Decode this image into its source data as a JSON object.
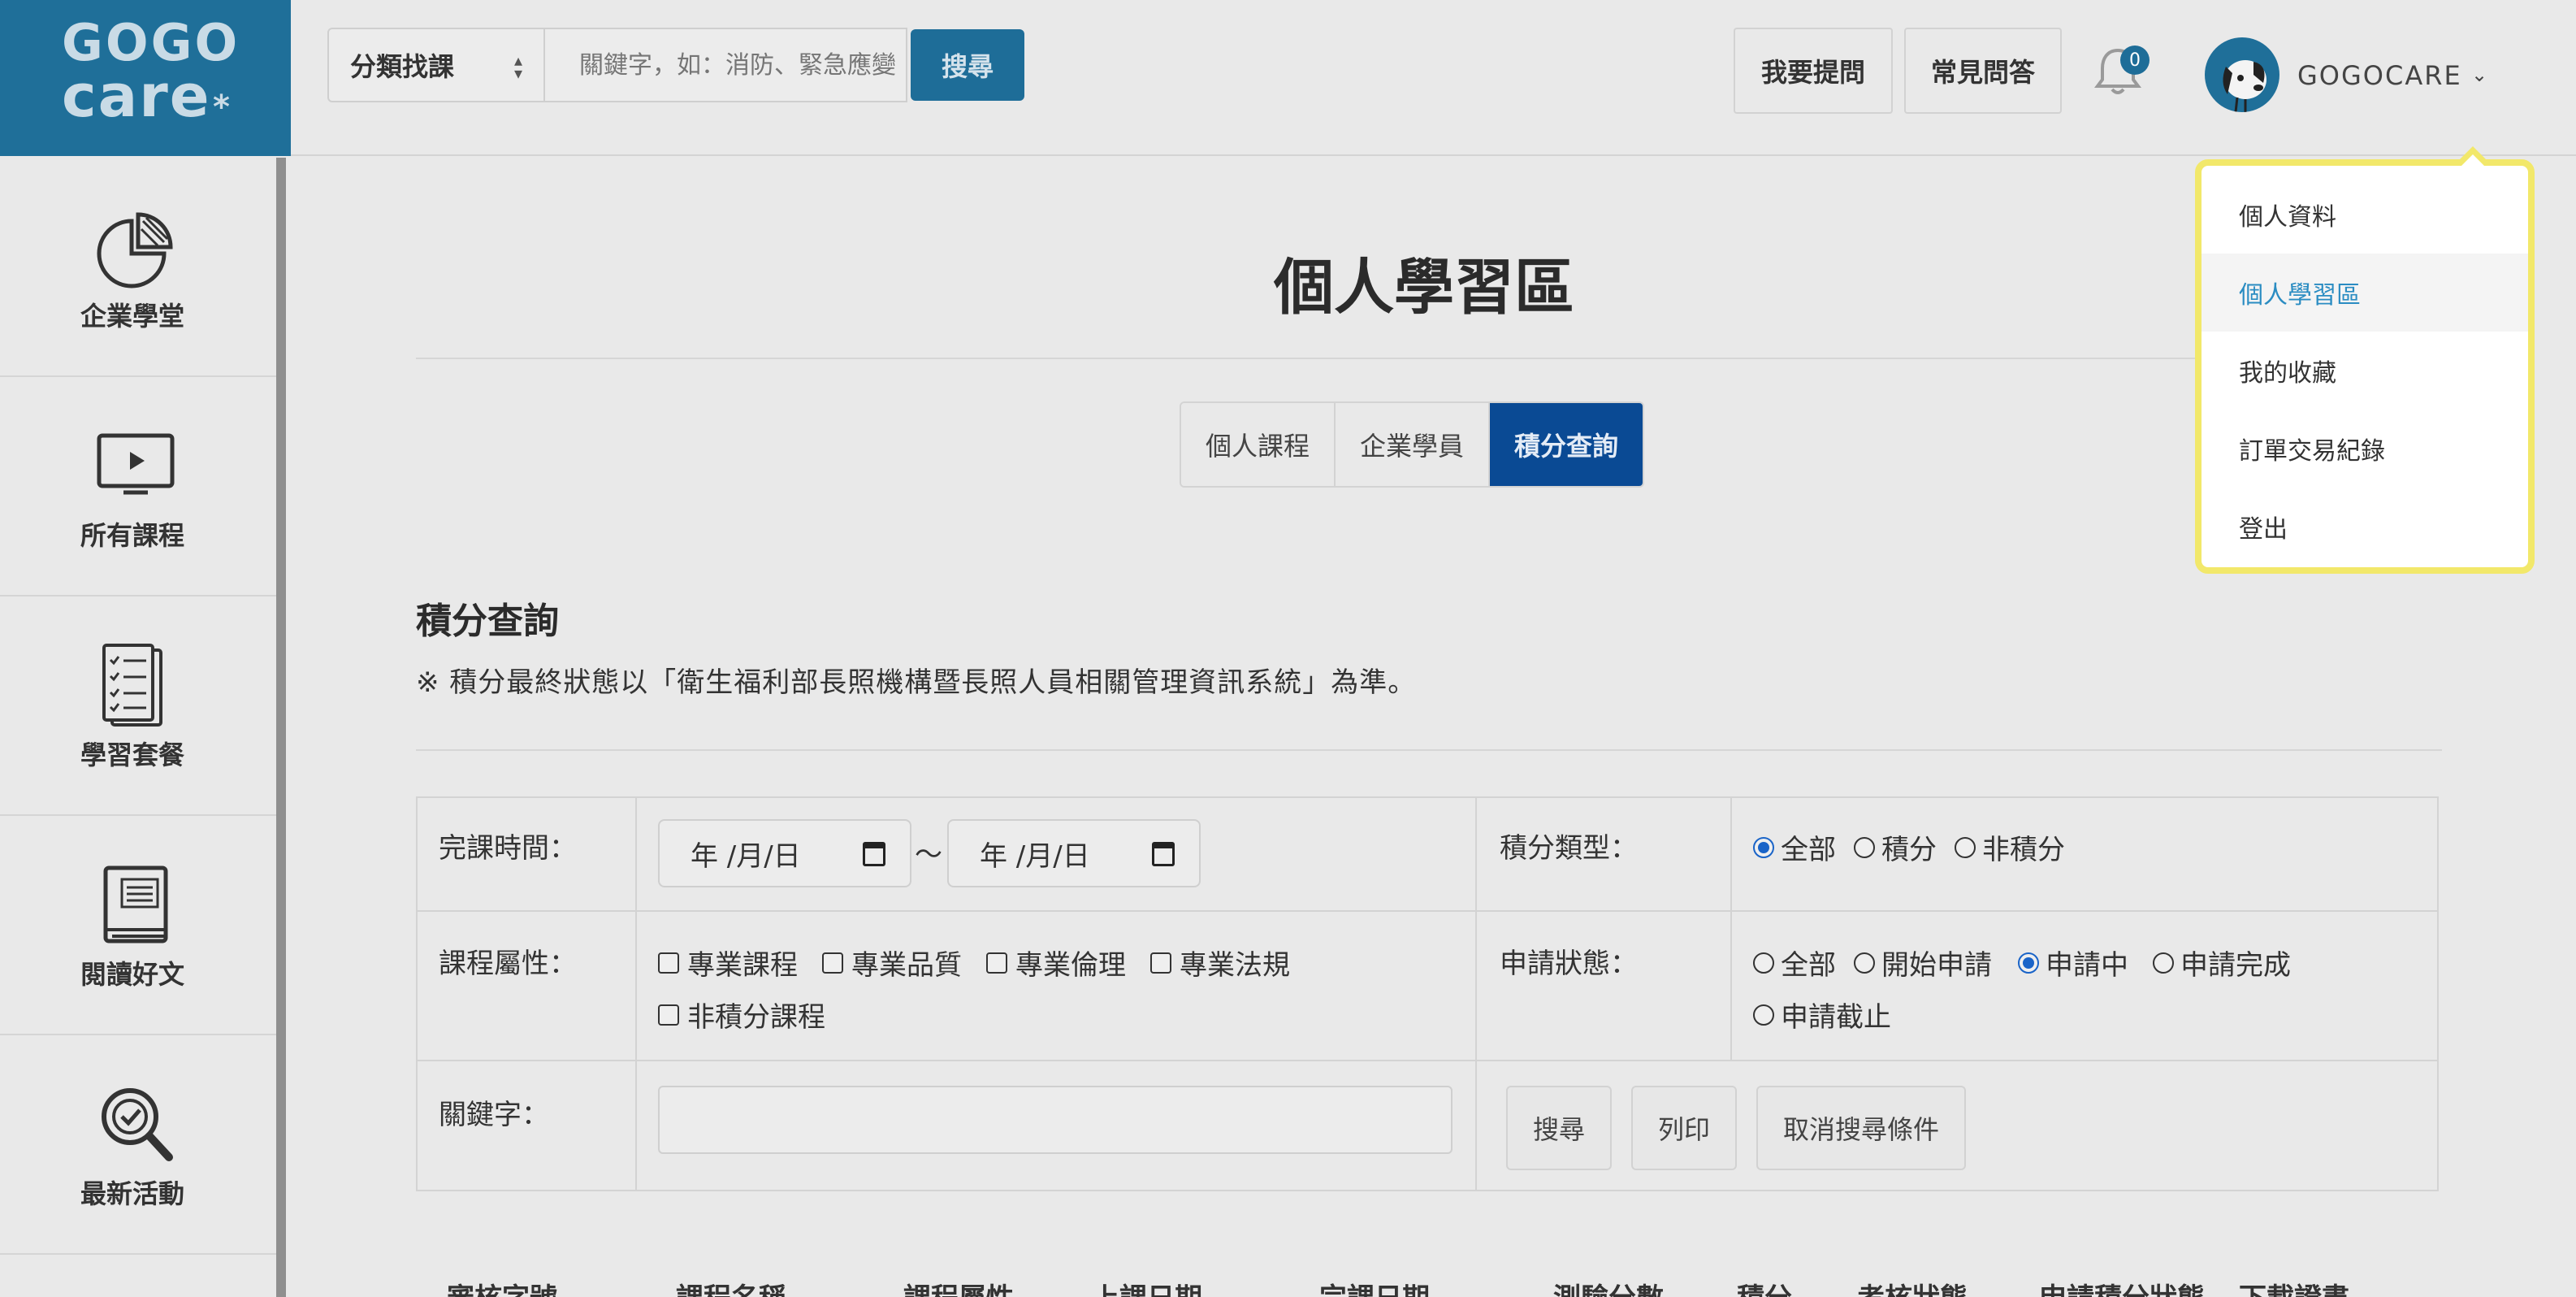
{
  "logo": {
    "line1": "GOGO",
    "line2": "care",
    "mark": "*"
  },
  "search": {
    "category_label": "分類找課",
    "placeholder": "關鍵字，如：消防、緊急應變",
    "button_label": "搜尋"
  },
  "header": {
    "ask_label": "我要提問",
    "faq_label": "常見問答",
    "notification_count": "0",
    "username": "GOGOCARE"
  },
  "sidebar": {
    "items": [
      {
        "label": "企業學堂",
        "icon": "pie-chart-icon"
      },
      {
        "label": "所有課程",
        "icon": "monitor-play-icon"
      },
      {
        "label": "學習套餐",
        "icon": "checklist-icon"
      },
      {
        "label": "閱讀好文",
        "icon": "book-icon"
      },
      {
        "label": "最新活動",
        "icon": "magnifier-check-icon"
      }
    ]
  },
  "page": {
    "title": "個人學習區",
    "tabs": [
      {
        "label": "個人課程",
        "active": false
      },
      {
        "label": "企業學員",
        "active": false
      },
      {
        "label": "積分查詢",
        "active": true
      }
    ],
    "section_title": "積分查詢",
    "section_note": "※ 積分最終狀態以「衛生福利部長照機構暨長照人員相關管理資訊系統」為準。"
  },
  "filters": {
    "date_label": "完課時間：",
    "date_from": "年 /月/日",
    "date_sep": "〜",
    "date_to": "年 /月/日",
    "credit_type_label": "積分類型：",
    "credit_type_options": [
      "全部",
      "積分",
      "非積分"
    ],
    "credit_type_selected": "全部",
    "attr_label": "課程屬性：",
    "attr_options": [
      "專業課程",
      "專業品質",
      "專業倫理",
      "專業法規",
      "非積分課程"
    ],
    "status_label": "申請狀態：",
    "status_options": [
      "全部",
      "開始申請",
      "申請中",
      "申請完成",
      "申請截止"
    ],
    "status_selected": "申請中",
    "keyword_label": "關鍵字：",
    "keyword_value": "",
    "search_btn": "搜尋",
    "print_btn": "列印",
    "clear_btn": "取消搜尋條件"
  },
  "table": {
    "headers": [
      "審核字號",
      "課程名稱",
      "課程屬性",
      "上課日期",
      "完課日期",
      "測驗分數",
      "積分",
      "考核狀態",
      "申請積分狀態",
      "下載證書"
    ]
  },
  "user_menu": {
    "items": [
      {
        "label": "個人資料",
        "active": false
      },
      {
        "label": "個人學習區",
        "active": true
      },
      {
        "label": "我的收藏",
        "active": false
      },
      {
        "label": "訂單交易紀錄",
        "active": false
      },
      {
        "label": "登出",
        "active": false
      }
    ]
  },
  "colors": {
    "brand": "#1f6f99",
    "active_tab": "#0a4a94",
    "menu_highlight": "#f2e86a",
    "menu_active_text": "#2a8cc2"
  }
}
